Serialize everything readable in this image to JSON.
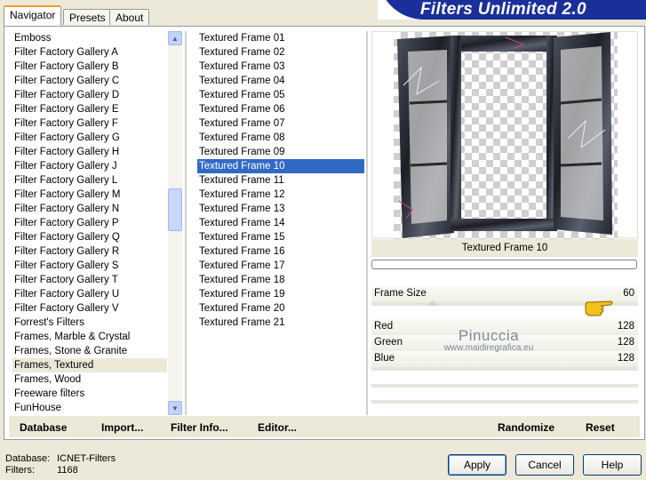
{
  "tabs": [
    "Navigator",
    "Presets",
    "About"
  ],
  "title": "Filters Unlimited 2.0",
  "categories": [
    "Emboss",
    "Filter Factory Gallery A",
    "Filter Factory Gallery B",
    "Filter Factory Gallery C",
    "Filter Factory Gallery D",
    "Filter Factory Gallery E",
    "Filter Factory Gallery F",
    "Filter Factory Gallery G",
    "Filter Factory Gallery H",
    "Filter Factory Gallery J",
    "Filter Factory Gallery L",
    "Filter Factory Gallery M",
    "Filter Factory Gallery N",
    "Filter Factory Gallery P",
    "Filter Factory Gallery Q",
    "Filter Factory Gallery R",
    "Filter Factory Gallery S",
    "Filter Factory Gallery T",
    "Filter Factory Gallery U",
    "Filter Factory Gallery V",
    "Forrest's Filters",
    "Frames, Marble & Crystal",
    "Frames, Stone & Granite",
    "Frames, Textured",
    "Frames, Wood",
    "Freeware filters",
    "FunHouse"
  ],
  "selected_category": "Frames, Textured",
  "filters": [
    "Textured Frame 01",
    "Textured Frame 02",
    "Textured Frame 03",
    "Textured Frame 04",
    "Textured Frame 05",
    "Textured Frame 06",
    "Textured Frame 07",
    "Textured Frame 08",
    "Textured Frame 09",
    "Textured Frame 10",
    "Textured Frame 11",
    "Textured Frame 12",
    "Textured Frame 13",
    "Textured Frame 14",
    "Textured Frame 15",
    "Textured Frame 16",
    "Textured Frame 17",
    "Textured Frame 18",
    "Textured Frame 19",
    "Textured Frame 20",
    "Textured Frame 21"
  ],
  "selected_filter": "Textured Frame 10",
  "preview_label": "Textured Frame 10",
  "controls": [
    {
      "label": "Frame Size",
      "value": "60"
    },
    {
      "label": "Red",
      "value": "128"
    },
    {
      "label": "Green",
      "value": "128"
    },
    {
      "label": "Blue",
      "value": "128"
    }
  ],
  "watermark": {
    "name": "Pinuccia",
    "site": "www.maidiregrafica.eu"
  },
  "bottom_buttons": {
    "database": "Database",
    "import": "Import...",
    "filter_info": "Filter Info...",
    "editor": "Editor...",
    "randomize": "Randomize",
    "reset": "Reset"
  },
  "status": {
    "database_label": "Database:",
    "database_value": "ICNET-Filters",
    "filters_label": "Filters:",
    "filters_value": "1168"
  },
  "dialog_buttons": {
    "apply": "Apply",
    "cancel": "Cancel",
    "help": "Help"
  },
  "colors": {
    "selection": "#316ac5",
    "title_bg": "#1a2f9a",
    "dialog_bg": "#ece9d8"
  }
}
